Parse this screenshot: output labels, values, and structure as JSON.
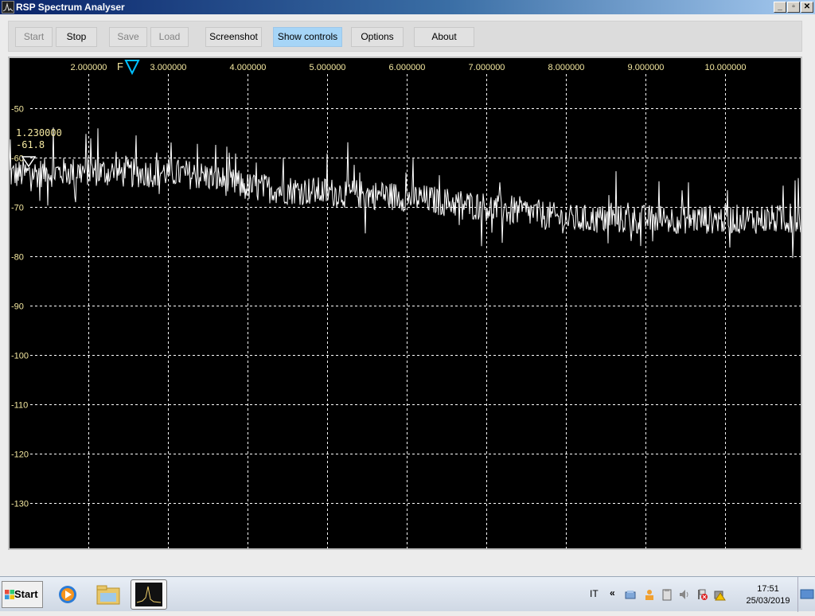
{
  "window": {
    "title": "RSP Spectrum Analyser",
    "controls": {
      "minimize": "_",
      "maximize": "▫",
      "close": "✕"
    }
  },
  "toolbar": {
    "buttons": [
      {
        "label": "Start",
        "state": "disabled"
      },
      {
        "label": "Stop",
        "state": "enabled"
      },
      {
        "label": "Save",
        "state": "disabled"
      },
      {
        "label": "Load",
        "state": "disabled"
      },
      {
        "label": "Screenshot",
        "state": "enabled"
      },
      {
        "label": "Show controls",
        "state": "active"
      },
      {
        "label": "Options",
        "state": "enabled"
      },
      {
        "label": "About",
        "state": "enabled"
      }
    ]
  },
  "spectrum": {
    "freq_marker_label": "F",
    "readout": {
      "frequency": "1.230000",
      "level": "-61.8"
    },
    "colors": {
      "background": "#000000",
      "grid": "#ffffff",
      "trace": "#ffffff",
      "axis_text": "#f4e8a0",
      "marker": "#00bfff"
    }
  },
  "chart_data": {
    "type": "line",
    "x_ticks": [
      "2.000000",
      "3.000000",
      "4.000000",
      "5.000000",
      "6.000000",
      "7.000000",
      "8.000000",
      "9.000000",
      "10.000000"
    ],
    "y_ticks": [
      "-50",
      "-60",
      "-70",
      "-80",
      "-90",
      "-100",
      "-110",
      "-120",
      "-130"
    ],
    "xlim": [
      1.01,
      10.95
    ],
    "ylim": [
      -130,
      -50
    ],
    "grid": true,
    "marker_frequency": 2.55,
    "series": [
      {
        "x": [
          1.01,
          1.5,
          2.0,
          2.5,
          3.0,
          3.5,
          4.0,
          4.5,
          5.0,
          5.5,
          6.0,
          6.5,
          7.0,
          7.5,
          8.0,
          8.5,
          9.0,
          9.5,
          10.0,
          10.5,
          10.95
        ],
        "values": [
          -63.5,
          -63.0,
          -62.8,
          -63.2,
          -63.0,
          -63.8,
          -66.0,
          -66.5,
          -67.0,
          -67.5,
          -68.0,
          -69.0,
          -70.0,
          -71.0,
          -72.5,
          -72.5,
          -72.5,
          -72.5,
          -72.5,
          -72.5,
          -72.5
        ]
      }
    ]
  },
  "taskbar": {
    "start_label": "Start",
    "language": "IT",
    "tray_expand": "«",
    "clock_time": "17:51",
    "clock_date": "25/03/2019",
    "items": [
      "media-player-icon",
      "file-explorer-icon",
      "spectrum-analyser-icon"
    ]
  }
}
